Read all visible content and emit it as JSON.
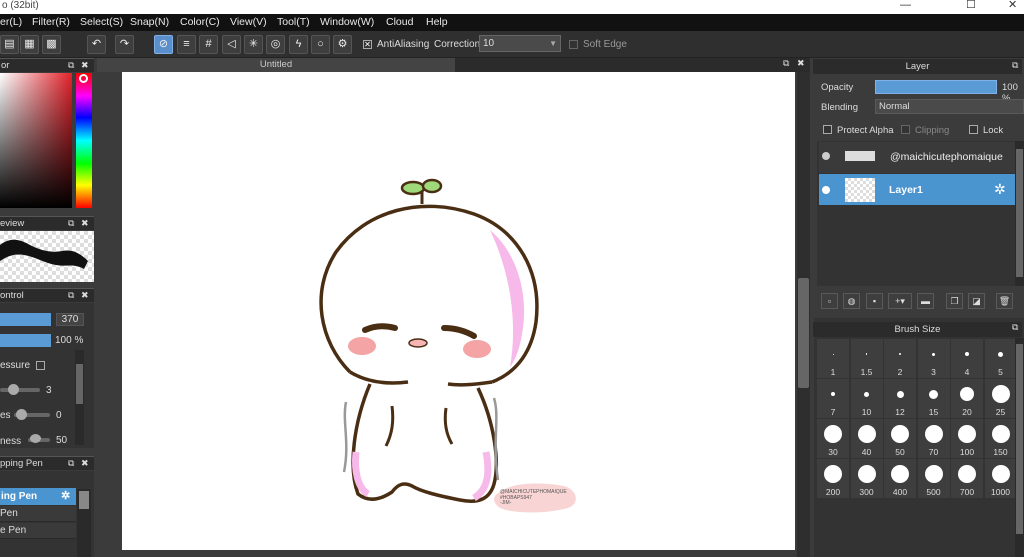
{
  "titlebar": {
    "title": "o (32bit)",
    "minimize": "—",
    "maximize": "☐",
    "close": "✕"
  },
  "menu": [
    "er(L)",
    "Filter(R)",
    "Select(S)",
    "Snap(N)",
    "Color(C)",
    "View(V)",
    "Tool(T)",
    "Window(W)",
    "Cloud",
    "Help"
  ],
  "toolbar": {
    "antialiasing_label": "AntiAliasing",
    "correction_label": "Correction",
    "correction_value": "10",
    "soft_edge_label": "Soft Edge"
  },
  "left": {
    "color_title": "or",
    "preview_title": "eview",
    "control_title": "ontrol",
    "size_value": "370",
    "opacity_value": "100 %",
    "pressure_label": "essure",
    "slider1_value": "3",
    "slider2_label": "es",
    "slider2_value": "0",
    "slider3_label": "ness",
    "slider3_value": "50",
    "brush_title": "pping Pen",
    "brushes": [
      "ing Pen",
      "Pen",
      "e Pen"
    ]
  },
  "canvas": {
    "tab_title": "Untitled"
  },
  "layer_panel": {
    "title": "Layer",
    "opacity_label": "Opacity",
    "opacity_value": "100 %",
    "opacity_fraction": 1.0,
    "blending_label": "Blending",
    "blending_value": "Normal",
    "protect_alpha_label": "Protect Alpha",
    "clipping_label": "Clipping",
    "lock_label": "Lock",
    "layers": [
      {
        "name": "@maichicutephomaique",
        "selected": false
      },
      {
        "name": "Layer1",
        "selected": true
      }
    ]
  },
  "brush_size": {
    "title": "Brush Size",
    "sizes": [
      "1",
      "1.5",
      "2",
      "3",
      "4",
      "5",
      "7",
      "10",
      "12",
      "15",
      "20",
      "25",
      "30",
      "40",
      "50",
      "70",
      "100",
      "150",
      "200",
      "300",
      "400",
      "500",
      "700",
      "1000"
    ]
  },
  "watermark": {
    "line1": "@MAICHICUTEPHOMAIQUE",
    "line2": "#HOBAPS947",
    "line3": "-JIM-"
  },
  "colors": {
    "accent": "#5a9bd5",
    "selected_layer": "#4a94d0",
    "canvas": "#ffffff",
    "outline": "#4a2e14",
    "pink": "#f7b8ea",
    "sprout": "#9fd97a"
  },
  "icons": {
    "undo": "undo-icon",
    "redo": "redo-icon",
    "settings": "gear-icon"
  }
}
